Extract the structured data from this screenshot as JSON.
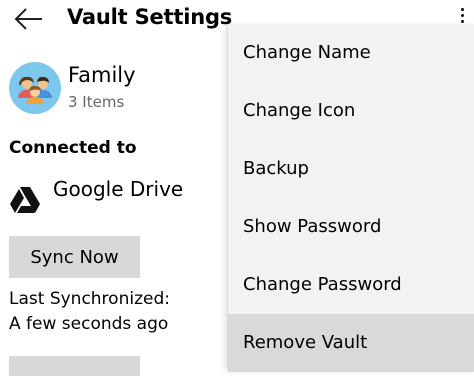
{
  "header": {
    "title": "Vault Settings",
    "back_icon": "arrow-left-icon",
    "more_icon": "more-vertical-icon"
  },
  "vault": {
    "name": "Family",
    "item_count": "3 Items",
    "icon": "family-group-icon",
    "avatar_color": "#7ec7ec"
  },
  "connection": {
    "label": "Connected to",
    "service": "Google Drive",
    "service_icon": "google-drive-icon"
  },
  "sync": {
    "button_label": "Sync Now",
    "last_sync_label": "Last Synchronized:",
    "last_sync_value": "A few seconds ago"
  },
  "menu": {
    "items": [
      {
        "label": "Change Name"
      },
      {
        "label": "Change Icon"
      },
      {
        "label": "Backup"
      },
      {
        "label": "Show Password"
      },
      {
        "label": "Change Password"
      },
      {
        "label": "Remove Vault",
        "highlighted": true
      }
    ],
    "background": "#f2f2f2",
    "highlight": "#d9d9d9"
  }
}
